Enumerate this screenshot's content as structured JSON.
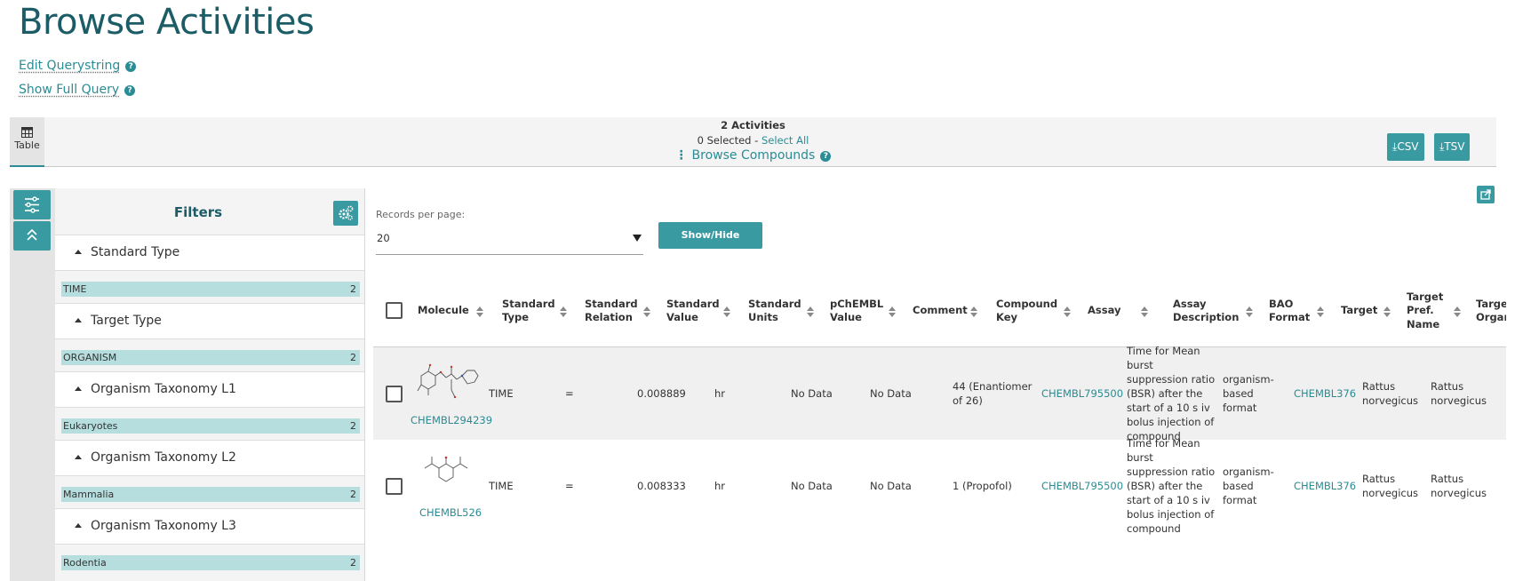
{
  "page": {
    "title": "Browse Activities"
  },
  "query_links": {
    "edit": "Edit Querystring",
    "show_full": "Show Full Query"
  },
  "toolbar": {
    "view_tab": "Table",
    "count": "2 Activities",
    "selected": "0 Selected - ",
    "select_all": "Select All",
    "browse_compounds": "Browse Compounds",
    "csv": "CSV",
    "tsv": "TSV"
  },
  "filters": {
    "title": "Filters",
    "groups": [
      {
        "label": "Standard Type",
        "value": "TIME",
        "count": "2"
      },
      {
        "label": "Target Type",
        "value": "ORGANISM",
        "count": "2"
      },
      {
        "label": "Organism Taxonomy L1",
        "value": "Eukaryotes",
        "count": "2"
      },
      {
        "label": "Organism Taxonomy L2",
        "value": "Mammalia",
        "count": "2"
      },
      {
        "label": "Organism Taxonomy L3",
        "value": "Rodentia",
        "count": "2"
      }
    ]
  },
  "table_controls": {
    "records_per_page_label": "Records per page:",
    "records_per_page": "20",
    "show_hide": "Show/Hide Columns"
  },
  "table": {
    "columns": [
      "Molecule",
      "Standard Type",
      "Standard Relation",
      "Standard Value",
      "Standard Units",
      "pChEMBL Value",
      "Comment",
      "Compound Key",
      "Assay",
      "Assay Description",
      "BAO Format",
      "Target",
      "Target Pref. Name",
      "Target Organism"
    ],
    "rows": [
      {
        "molecule": "CHEMBL294239",
        "standard_type": "TIME",
        "standard_relation": "=",
        "standard_value": "0.008889",
        "standard_units": "hr",
        "pchembl": "No Data",
        "comment": "No Data",
        "compound_key": "44 (Enantiomer of 26)",
        "assay": "CHEMBL795500",
        "assay_description": "Time for Mean burst suppression ratio (BSR) after the start of a 10 s iv bolus injection of compound",
        "bao_format": "organism-based format",
        "target": "CHEMBL376",
        "target_pref_name": "Rattus norvegicus",
        "target_organism": "Rattus norvegicus"
      },
      {
        "molecule": "CHEMBL526",
        "standard_type": "TIME",
        "standard_relation": "=",
        "standard_value": "0.008333",
        "standard_units": "hr",
        "pchembl": "No Data",
        "comment": "No Data",
        "compound_key": "1 (Propofol)",
        "assay": "CHEMBL795500",
        "assay_description": "Time for Mean burst suppression ratio (BSR) after the start of a 10 s iv bolus injection of compound",
        "bao_format": "organism-based format",
        "target": "CHEMBL376",
        "target_pref_name": "Rattus norvegicus",
        "target_organism": "Rattus norvegicus"
      }
    ]
  },
  "colors": {
    "accent": "#2a8c94",
    "button": "#3a9aa1",
    "title": "#1c5c66",
    "filter_bar": "#b6dede"
  }
}
